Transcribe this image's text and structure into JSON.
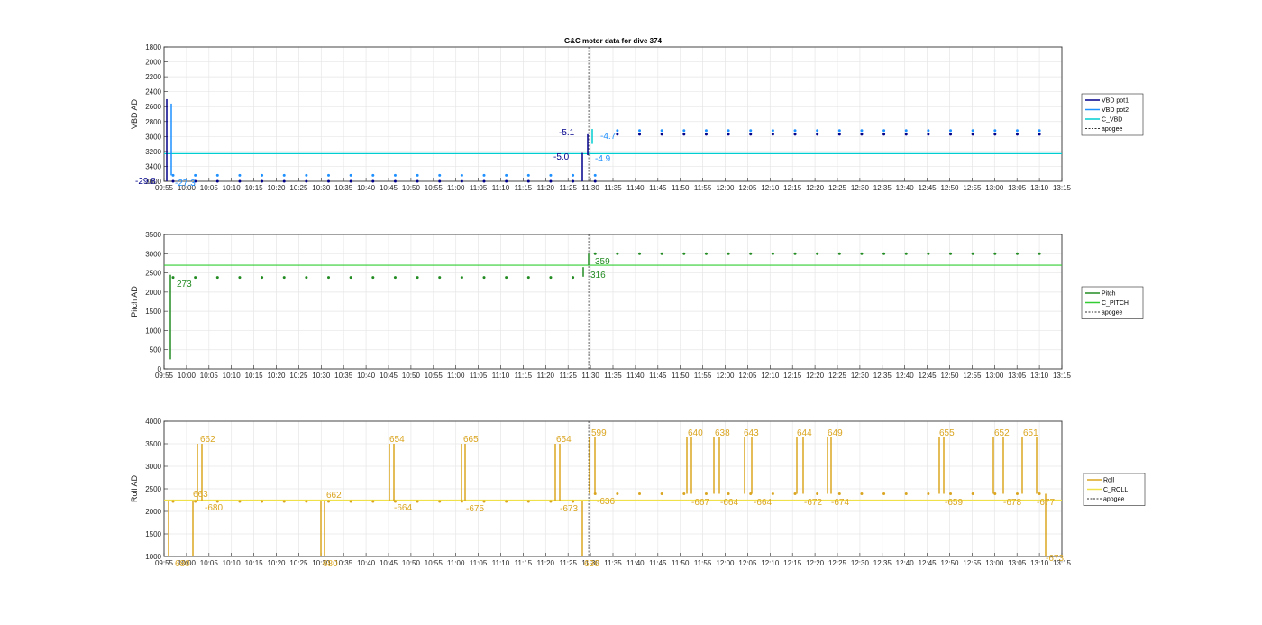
{
  "figure_title": "G&C motor data for dive 374",
  "chart_data": [
    {
      "type": "scatter",
      "ylabel": "VBD AD",
      "xlabel": "",
      "x_ticks": [
        "09:55",
        "10:00",
        "10:05",
        "10:10",
        "10:15",
        "10:20",
        "10:25",
        "10:30",
        "10:35",
        "10:40",
        "10:45",
        "10:50",
        "10:55",
        "11:00",
        "11:05",
        "11:10",
        "11:15",
        "11:20",
        "11:25",
        "11:30",
        "11:35",
        "11:40",
        "11:45",
        "11:50",
        "11:55",
        "12:00",
        "12:05",
        "12:10",
        "12:15",
        "12:20",
        "12:25",
        "12:30",
        "12:35",
        "12:40",
        "12:45",
        "12:50",
        "12:55",
        "13:00",
        "13:05",
        "13:10",
        "13:15"
      ],
      "y_ticks": [
        "1800",
        "2000",
        "2200",
        "2400",
        "2600",
        "2800",
        "3000",
        "3200",
        "3400",
        "3600"
      ],
      "ylim": [
        1800,
        3600
      ],
      "y_reversed": true,
      "grid": true,
      "legend_position": "right",
      "legend": [
        "VBD pot1",
        "VBD pot2",
        "C_VBD",
        "apogee"
      ],
      "series": [
        {
          "name": "VBD pot1",
          "color": "#00008b",
          "values": [
            3600,
            3600,
            3600,
            3600,
            3600,
            3600,
            3600,
            3600,
            3600,
            3600,
            3600,
            3600,
            3600,
            3600,
            3600,
            3600,
            3600,
            3600,
            3600,
            3600,
            2970,
            2970,
            2970,
            2970,
            2970,
            2970,
            2970,
            2970,
            2970,
            2970,
            2970,
            2970,
            2970,
            2970,
            2970,
            2970,
            2970,
            2970,
            2970,
            2970
          ]
        },
        {
          "name": "VBD pot2",
          "color": "#1e90ff",
          "values": [
            3520,
            3520,
            3520,
            3520,
            3520,
            3520,
            3520,
            3520,
            3520,
            3520,
            3520,
            3520,
            3520,
            3520,
            3520,
            3520,
            3520,
            3520,
            3520,
            3520,
            2920,
            2920,
            2920,
            2920,
            2920,
            2920,
            2920,
            2920,
            2920,
            2920,
            2920,
            2920,
            2920,
            2920,
            2920,
            2920,
            2920,
            2920,
            2920,
            2920
          ]
        }
      ],
      "reference_line": {
        "name": "C_VBD",
        "value": 3230,
        "color": "#00ced1"
      },
      "apogee": "11:30",
      "annotations": [
        "-29.8",
        "-27.3",
        "-5.1",
        "-5.0",
        "-4.7",
        "-4.9"
      ]
    },
    {
      "type": "scatter",
      "ylabel": "Pitch AD",
      "xlabel": "",
      "x_ticks": [
        "09:55",
        "10:00",
        "10:05",
        "10:10",
        "10:15",
        "10:20",
        "10:25",
        "10:30",
        "10:35",
        "10:40",
        "10:45",
        "10:50",
        "10:55",
        "11:00",
        "11:05",
        "11:10",
        "11:15",
        "11:20",
        "11:25",
        "11:30",
        "11:35",
        "11:40",
        "11:45",
        "11:50",
        "11:55",
        "12:00",
        "12:05",
        "12:10",
        "12:15",
        "12:20",
        "12:25",
        "12:30",
        "12:35",
        "12:40",
        "12:45",
        "12:50",
        "12:55",
        "13:00",
        "13:05",
        "13:10",
        "13:15"
      ],
      "y_ticks": [
        "0",
        "500",
        "1000",
        "1500",
        "2000",
        "2500",
        "3000",
        "3500"
      ],
      "ylim": [
        0,
        3500
      ],
      "grid": true,
      "legend_position": "right",
      "legend": [
        "Pitch",
        "C_PITCH",
        "apogee"
      ],
      "series": [
        {
          "name": "Pitch",
          "color": "#228b22",
          "values": [
            2380,
            2380,
            2380,
            2380,
            2380,
            2380,
            2380,
            2380,
            2380,
            2380,
            2380,
            2380,
            2380,
            2380,
            2380,
            2380,
            2380,
            2380,
            2380,
            3000,
            3000,
            3000,
            3000,
            3000,
            3000,
            3000,
            3000,
            3000,
            3000,
            3000,
            3000,
            3000,
            3000,
            3000,
            3000,
            3000,
            3000,
            3000,
            3000,
            3000
          ]
        }
      ],
      "reference_line": {
        "name": "C_PITCH",
        "value": 2700,
        "color": "#32cd32"
      },
      "apogee": "11:30",
      "annotations": [
        "273",
        "359",
        "316"
      ]
    },
    {
      "type": "scatter",
      "ylabel": "Roll AD",
      "xlabel": "",
      "x_ticks": [
        "09:55",
        "10:00",
        "10:05",
        "10:10",
        "10:15",
        "10:20",
        "10:25",
        "10:30",
        "10:35",
        "10:40",
        "10:45",
        "10:50",
        "10:55",
        "11:00",
        "11:05",
        "11:10",
        "11:15",
        "11:20",
        "11:25",
        "11:30",
        "11:35",
        "11:40",
        "11:45",
        "11:50",
        "11:55",
        "12:00",
        "12:05",
        "12:10",
        "12:15",
        "12:20",
        "12:25",
        "12:30",
        "12:35",
        "12:40",
        "12:45",
        "12:50",
        "12:55",
        "13:00",
        "13:05",
        "13:10",
        "13:15"
      ],
      "y_ticks": [
        "1000",
        "1500",
        "2000",
        "2500",
        "3000",
        "3500",
        "4000"
      ],
      "ylim": [
        1000,
        4000
      ],
      "grid": true,
      "legend_position": "right",
      "legend": [
        "Roll",
        "C_ROLL",
        "apogee"
      ],
      "series": [
        {
          "name": "Roll",
          "color": "#daa520",
          "values": [
            2220,
            2220,
            2220,
            2220,
            2220,
            2220,
            2220,
            2220,
            2220,
            2220,
            2220,
            2220,
            2220,
            2220,
            2220,
            2220,
            2220,
            2220,
            2220,
            2390,
            2390,
            2390,
            2390,
            2390,
            2390,
            2390,
            2390,
            2390,
            2390,
            2390,
            2390,
            2390,
            2390,
            2390,
            2390,
            2390,
            2390,
            2390,
            2390,
            2390
          ]
        }
      ],
      "reference_line": {
        "name": "C_ROLL",
        "value": 2250,
        "color": "#f0e14a"
      },
      "apogee": "11:30",
      "annotations": [
        "662",
        "680",
        "663",
        "-680",
        "662",
        "680",
        "654",
        "-664",
        "665",
        "-675",
        "654",
        "-673",
        "636",
        "599",
        "-636",
        "640",
        "-667",
        "638",
        "-664",
        "643",
        "-664",
        "644",
        "-672",
        "649",
        "-674",
        "655",
        "-659",
        "652",
        "-678",
        "651",
        "-677",
        "-673"
      ]
    }
  ]
}
